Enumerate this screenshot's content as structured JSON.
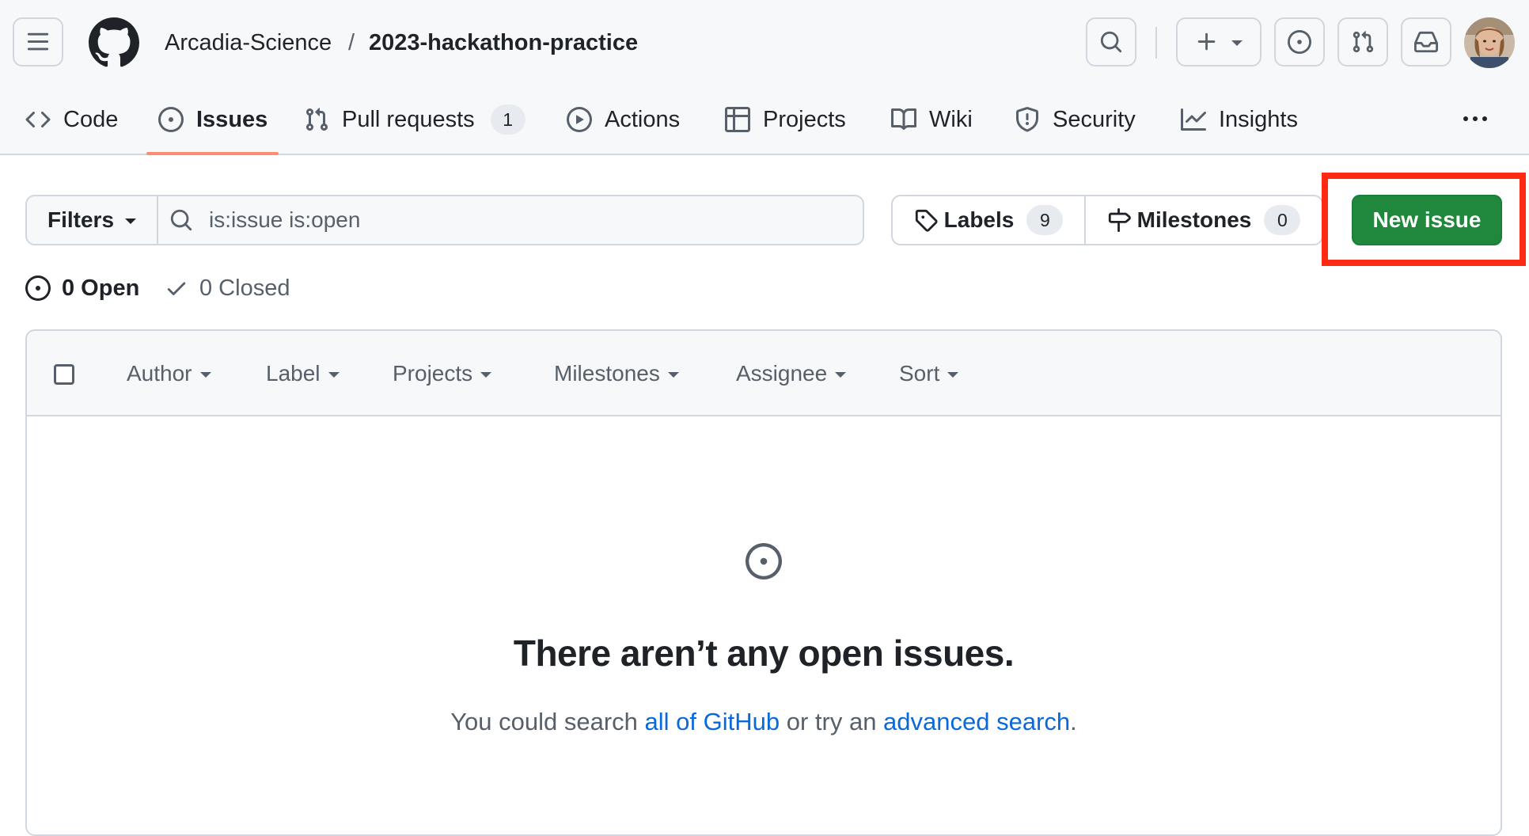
{
  "header": {
    "owner": "Arcadia-Science",
    "separator": "/",
    "repo": "2023-hackathon-practice"
  },
  "tabs": [
    {
      "label": "Code",
      "icon": "code-icon"
    },
    {
      "label": "Issues",
      "icon": "issue-opened-icon",
      "selected": true
    },
    {
      "label": "Pull requests",
      "icon": "git-pull-request-icon",
      "count": "1"
    },
    {
      "label": "Actions",
      "icon": "play-icon"
    },
    {
      "label": "Projects",
      "icon": "table-icon"
    },
    {
      "label": "Wiki",
      "icon": "book-icon"
    },
    {
      "label": "Security",
      "icon": "shield-icon"
    },
    {
      "label": "Insights",
      "icon": "graph-icon"
    }
  ],
  "toolbar": {
    "filters_label": "Filters",
    "search_value": "is:issue is:open",
    "labels_label": "Labels",
    "labels_count": "9",
    "milestones_label": "Milestones",
    "milestones_count": "0",
    "new_issue_label": "New issue"
  },
  "states": {
    "open_label": "0 Open",
    "closed_label": "0 Closed"
  },
  "facets": [
    "Author",
    "Label",
    "Projects",
    "Milestones",
    "Assignee",
    "Sort"
  ],
  "blankslate": {
    "title": "There aren’t any open issues.",
    "text_before": "You could search ",
    "link1": "all of GitHub",
    "text_middle": " or try an ",
    "link2": "advanced search",
    "text_after": "."
  },
  "colors": {
    "accent_underline": "#fd8c73",
    "primary_button": "#1f883d",
    "link": "#0969da",
    "highlight_box": "#ff2a12"
  }
}
